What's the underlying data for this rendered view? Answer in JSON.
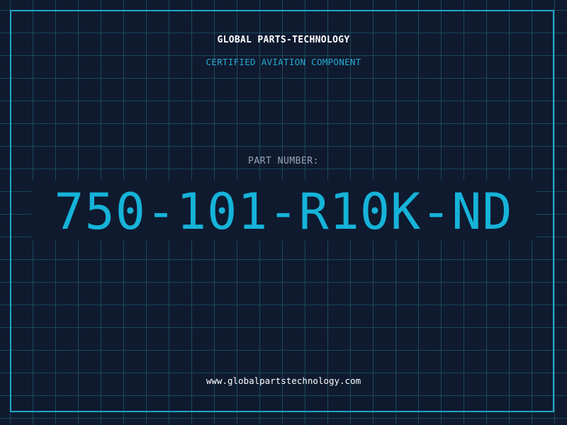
{
  "header": {
    "company": "GLOBAL PARTS-TECHNOLOGY",
    "subtitle": "CERTIFIED AVIATION COMPONENT"
  },
  "part": {
    "label": "PART NUMBER:",
    "number": "750-101-R10K-ND"
  },
  "footer": {
    "website": "www.globalpartstechnology.com"
  },
  "colors": {
    "background": "#0f1a2f",
    "grid": "#226e82",
    "frame": "#1fa7c9",
    "accent": "#16b3d9",
    "label": "#9aa4b4",
    "text": "#ffffff"
  }
}
